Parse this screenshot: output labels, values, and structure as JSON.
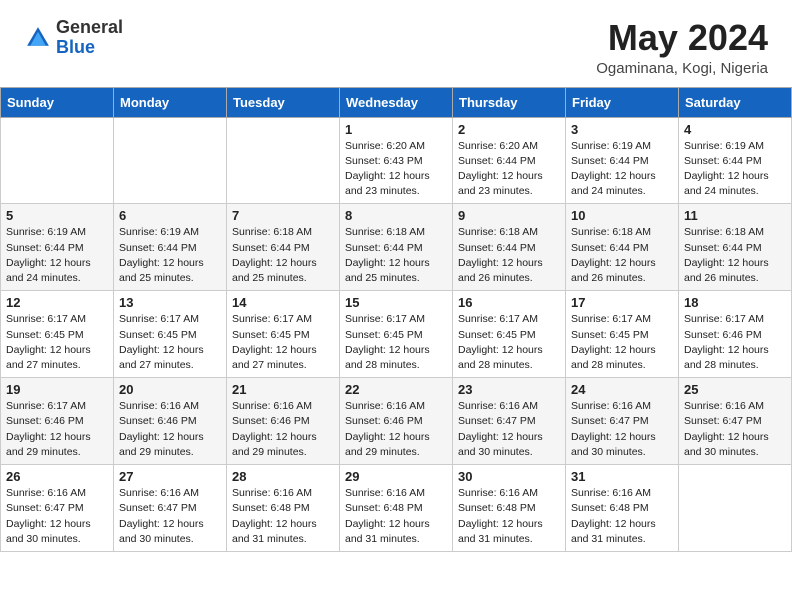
{
  "header": {
    "logo_general": "General",
    "logo_blue": "Blue",
    "month_year": "May 2024",
    "location": "Ogaminana, Kogi, Nigeria"
  },
  "days_of_week": [
    "Sunday",
    "Monday",
    "Tuesday",
    "Wednesday",
    "Thursday",
    "Friday",
    "Saturday"
  ],
  "weeks": [
    [
      {
        "day": "",
        "content": ""
      },
      {
        "day": "",
        "content": ""
      },
      {
        "day": "",
        "content": ""
      },
      {
        "day": "1",
        "content": "Sunrise: 6:20 AM\nSunset: 6:43 PM\nDaylight: 12 hours and 23 minutes."
      },
      {
        "day": "2",
        "content": "Sunrise: 6:20 AM\nSunset: 6:44 PM\nDaylight: 12 hours and 23 minutes."
      },
      {
        "day": "3",
        "content": "Sunrise: 6:19 AM\nSunset: 6:44 PM\nDaylight: 12 hours and 24 minutes."
      },
      {
        "day": "4",
        "content": "Sunrise: 6:19 AM\nSunset: 6:44 PM\nDaylight: 12 hours and 24 minutes."
      }
    ],
    [
      {
        "day": "5",
        "content": "Sunrise: 6:19 AM\nSunset: 6:44 PM\nDaylight: 12 hours and 24 minutes."
      },
      {
        "day": "6",
        "content": "Sunrise: 6:19 AM\nSunset: 6:44 PM\nDaylight: 12 hours and 25 minutes."
      },
      {
        "day": "7",
        "content": "Sunrise: 6:18 AM\nSunset: 6:44 PM\nDaylight: 12 hours and 25 minutes."
      },
      {
        "day": "8",
        "content": "Sunrise: 6:18 AM\nSunset: 6:44 PM\nDaylight: 12 hours and 25 minutes."
      },
      {
        "day": "9",
        "content": "Sunrise: 6:18 AM\nSunset: 6:44 PM\nDaylight: 12 hours and 26 minutes."
      },
      {
        "day": "10",
        "content": "Sunrise: 6:18 AM\nSunset: 6:44 PM\nDaylight: 12 hours and 26 minutes."
      },
      {
        "day": "11",
        "content": "Sunrise: 6:18 AM\nSunset: 6:44 PM\nDaylight: 12 hours and 26 minutes."
      }
    ],
    [
      {
        "day": "12",
        "content": "Sunrise: 6:17 AM\nSunset: 6:45 PM\nDaylight: 12 hours and 27 minutes."
      },
      {
        "day": "13",
        "content": "Sunrise: 6:17 AM\nSunset: 6:45 PM\nDaylight: 12 hours and 27 minutes."
      },
      {
        "day": "14",
        "content": "Sunrise: 6:17 AM\nSunset: 6:45 PM\nDaylight: 12 hours and 27 minutes."
      },
      {
        "day": "15",
        "content": "Sunrise: 6:17 AM\nSunset: 6:45 PM\nDaylight: 12 hours and 28 minutes."
      },
      {
        "day": "16",
        "content": "Sunrise: 6:17 AM\nSunset: 6:45 PM\nDaylight: 12 hours and 28 minutes."
      },
      {
        "day": "17",
        "content": "Sunrise: 6:17 AM\nSunset: 6:45 PM\nDaylight: 12 hours and 28 minutes."
      },
      {
        "day": "18",
        "content": "Sunrise: 6:17 AM\nSunset: 6:46 PM\nDaylight: 12 hours and 28 minutes."
      }
    ],
    [
      {
        "day": "19",
        "content": "Sunrise: 6:17 AM\nSunset: 6:46 PM\nDaylight: 12 hours and 29 minutes."
      },
      {
        "day": "20",
        "content": "Sunrise: 6:16 AM\nSunset: 6:46 PM\nDaylight: 12 hours and 29 minutes."
      },
      {
        "day": "21",
        "content": "Sunrise: 6:16 AM\nSunset: 6:46 PM\nDaylight: 12 hours and 29 minutes."
      },
      {
        "day": "22",
        "content": "Sunrise: 6:16 AM\nSunset: 6:46 PM\nDaylight: 12 hours and 29 minutes."
      },
      {
        "day": "23",
        "content": "Sunrise: 6:16 AM\nSunset: 6:47 PM\nDaylight: 12 hours and 30 minutes."
      },
      {
        "day": "24",
        "content": "Sunrise: 6:16 AM\nSunset: 6:47 PM\nDaylight: 12 hours and 30 minutes."
      },
      {
        "day": "25",
        "content": "Sunrise: 6:16 AM\nSunset: 6:47 PM\nDaylight: 12 hours and 30 minutes."
      }
    ],
    [
      {
        "day": "26",
        "content": "Sunrise: 6:16 AM\nSunset: 6:47 PM\nDaylight: 12 hours and 30 minutes."
      },
      {
        "day": "27",
        "content": "Sunrise: 6:16 AM\nSunset: 6:47 PM\nDaylight: 12 hours and 30 minutes."
      },
      {
        "day": "28",
        "content": "Sunrise: 6:16 AM\nSunset: 6:48 PM\nDaylight: 12 hours and 31 minutes."
      },
      {
        "day": "29",
        "content": "Sunrise: 6:16 AM\nSunset: 6:48 PM\nDaylight: 12 hours and 31 minutes."
      },
      {
        "day": "30",
        "content": "Sunrise: 6:16 AM\nSunset: 6:48 PM\nDaylight: 12 hours and 31 minutes."
      },
      {
        "day": "31",
        "content": "Sunrise: 6:16 AM\nSunset: 6:48 PM\nDaylight: 12 hours and 31 minutes."
      },
      {
        "day": "",
        "content": ""
      }
    ]
  ]
}
